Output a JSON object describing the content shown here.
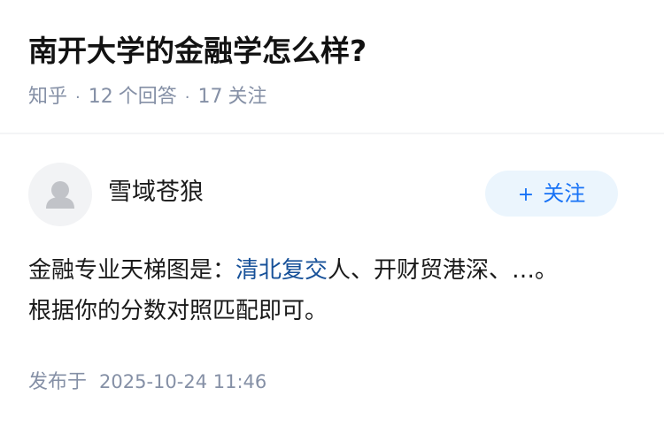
{
  "question": {
    "title": "南开大学的金融学怎么样?",
    "source": "知乎",
    "answer_count": "12",
    "answer_label": "个回答",
    "follow_count": "17",
    "follow_label": "关注"
  },
  "answer": {
    "author_name": "雪域苍狼",
    "follow_button": {
      "icon": "+",
      "label": "关注"
    },
    "content": {
      "line1_prefix": "金融专业天梯图是：",
      "line1_link": "清北复交",
      "line1_suffix": "人、开财贸港深、…。",
      "line2": "根据你的分数对照匹配即可。"
    },
    "published_label": "发布于",
    "published_time": "2025-10-24 11:46"
  },
  "colors": {
    "link": "#175199",
    "accent": "#1772f6",
    "meta": "#8590a6",
    "follow_bg": "#ebf5fd"
  }
}
